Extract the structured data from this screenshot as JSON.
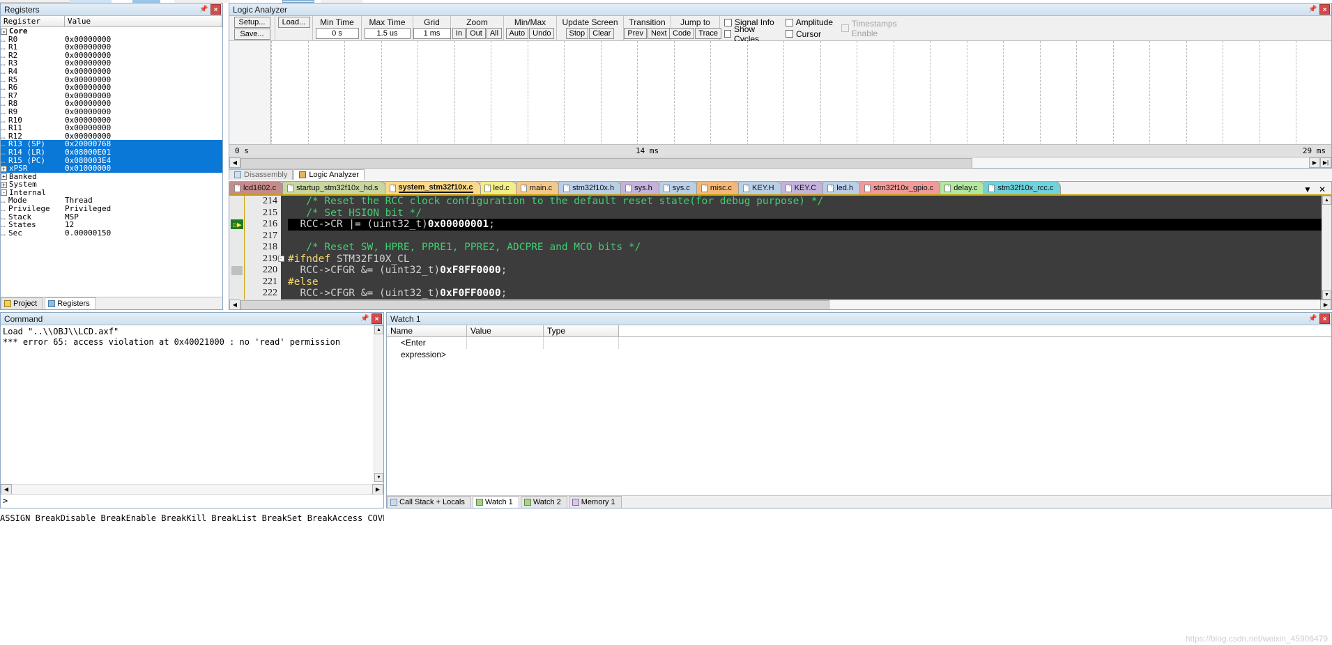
{
  "registers": {
    "title": "Registers",
    "columns": [
      "Register",
      "Value"
    ],
    "rows": [
      {
        "name": "Core",
        "value": "",
        "indent": 0,
        "expander": "-",
        "group": true,
        "selected": false
      },
      {
        "name": "R0",
        "value": "0x00000000",
        "indent": 2,
        "expander": "",
        "group": false,
        "selected": false
      },
      {
        "name": "R1",
        "value": "0x00000000",
        "indent": 2,
        "expander": "",
        "group": false,
        "selected": false
      },
      {
        "name": "R2",
        "value": "0x00000000",
        "indent": 2,
        "expander": "",
        "group": false,
        "selected": false
      },
      {
        "name": "R3",
        "value": "0x00000000",
        "indent": 2,
        "expander": "",
        "group": false,
        "selected": false
      },
      {
        "name": "R4",
        "value": "0x00000000",
        "indent": 2,
        "expander": "",
        "group": false,
        "selected": false
      },
      {
        "name": "R5",
        "value": "0x00000000",
        "indent": 2,
        "expander": "",
        "group": false,
        "selected": false
      },
      {
        "name": "R6",
        "value": "0x00000000",
        "indent": 2,
        "expander": "",
        "group": false,
        "selected": false
      },
      {
        "name": "R7",
        "value": "0x00000000",
        "indent": 2,
        "expander": "",
        "group": false,
        "selected": false
      },
      {
        "name": "R8",
        "value": "0x00000000",
        "indent": 2,
        "expander": "",
        "group": false,
        "selected": false
      },
      {
        "name": "R9",
        "value": "0x00000000",
        "indent": 2,
        "expander": "",
        "group": false,
        "selected": false
      },
      {
        "name": "R10",
        "value": "0x00000000",
        "indent": 2,
        "expander": "",
        "group": false,
        "selected": false
      },
      {
        "name": "R11",
        "value": "0x00000000",
        "indent": 2,
        "expander": "",
        "group": false,
        "selected": false
      },
      {
        "name": "R12",
        "value": "0x00000000",
        "indent": 2,
        "expander": "",
        "group": false,
        "selected": false
      },
      {
        "name": "R13 (SP)",
        "value": "0x20000768",
        "indent": 2,
        "expander": "",
        "group": false,
        "selected": true
      },
      {
        "name": "R14 (LR)",
        "value": "0x08000E01",
        "indent": 2,
        "expander": "",
        "group": false,
        "selected": true
      },
      {
        "name": "R15 (PC)",
        "value": "0x080003E4",
        "indent": 2,
        "expander": "",
        "group": false,
        "selected": true
      },
      {
        "name": "xPSR",
        "value": "0x01000000",
        "indent": 1,
        "expander": "+",
        "group": false,
        "selected": true
      },
      {
        "name": "Banked",
        "value": "",
        "indent": 0,
        "expander": "+",
        "group": false,
        "selected": false
      },
      {
        "name": "System",
        "value": "",
        "indent": 0,
        "expander": "+",
        "group": false,
        "selected": false
      },
      {
        "name": "Internal",
        "value": "",
        "indent": 0,
        "expander": "-",
        "group": false,
        "selected": false
      },
      {
        "name": "Mode",
        "value": "Thread",
        "indent": 2,
        "expander": "",
        "group": false,
        "selected": false
      },
      {
        "name": "Privilege",
        "value": "Privileged",
        "indent": 2,
        "expander": "",
        "group": false,
        "selected": false
      },
      {
        "name": "Stack",
        "value": "MSP",
        "indent": 2,
        "expander": "",
        "group": false,
        "selected": false
      },
      {
        "name": "States",
        "value": "12",
        "indent": 2,
        "expander": "",
        "group": false,
        "selected": false
      },
      {
        "name": "Sec",
        "value": "0.00000150",
        "indent": 2,
        "expander": "",
        "group": false,
        "selected": false
      }
    ],
    "bottom_tabs": [
      {
        "label": "Project",
        "active": false,
        "icon": "project-icon"
      },
      {
        "label": "Registers",
        "active": true,
        "icon": "registers-icon"
      }
    ]
  },
  "logic_analyzer": {
    "title": "Logic Analyzer",
    "buttons": {
      "setup": "Setup...",
      "load": "Load...",
      "save": "Save..."
    },
    "groups": [
      {
        "label": "Min Time",
        "value": "0 s"
      },
      {
        "label": "Max Time",
        "value": "1.5 us"
      },
      {
        "label": "Grid",
        "value": "1 ms"
      }
    ],
    "zoom": {
      "label": "Zoom",
      "buttons": [
        "In",
        "Out",
        "All"
      ]
    },
    "minmax": {
      "label": "Min/Max",
      "buttons": [
        "Auto",
        "Undo"
      ]
    },
    "update_screen": {
      "label": "Update Screen",
      "buttons": [
        "Stop",
        "Clear"
      ]
    },
    "transition": {
      "label": "Transition",
      "buttons": [
        "Prev",
        "Next"
      ]
    },
    "jump_to": {
      "label": "Jump to",
      "buttons": [
        "Code",
        "Trace"
      ]
    },
    "checkboxes": [
      {
        "label": "Signal Info",
        "checked": false,
        "disabled": false
      },
      {
        "label": "Show Cycles",
        "checked": false,
        "disabled": false
      },
      {
        "label": "Amplitude",
        "checked": false,
        "disabled": false
      },
      {
        "label": "Cursor",
        "checked": false,
        "disabled": false
      },
      {
        "label": "Timestamps Enable",
        "checked": false,
        "disabled": true
      }
    ],
    "axis": {
      "left": "0 s",
      "center": "14 ms",
      "right": "29 ms"
    }
  },
  "view_tabs": [
    {
      "label": "Disassembly",
      "active": false,
      "icon": "disassembly-icon"
    },
    {
      "label": "Logic Analyzer",
      "active": true,
      "icon": "logic-analyzer-icon"
    }
  ],
  "editor": {
    "file_tabs": [
      {
        "label": "lcd1602.c",
        "color": "#c58b8b",
        "active": false
      },
      {
        "label": "startup_stm32f10x_hd.s",
        "color": "#c8d6a0",
        "active": false
      },
      {
        "label": "system_stm32f10x.c",
        "color": "#fcd98a",
        "active": true
      },
      {
        "label": "led.c",
        "color": "#f2ef88",
        "active": false
      },
      {
        "label": "main.c",
        "color": "#f3c98b",
        "active": false
      },
      {
        "label": "stm32f10x.h",
        "color": "#b9cfe8",
        "active": false
      },
      {
        "label": "sys.h",
        "color": "#c4b2dd",
        "active": false
      },
      {
        "label": "sys.c",
        "color": "#b9cfe8",
        "active": false
      },
      {
        "label": "misc.c",
        "color": "#f3b878",
        "active": false
      },
      {
        "label": "KEY.H",
        "color": "#b9cfe8",
        "active": false
      },
      {
        "label": "KEY.C",
        "color": "#c4b2dd",
        "active": false
      },
      {
        "label": "led.h",
        "color": "#b9cfe8",
        "active": false
      },
      {
        "label": "stm32f10x_gpio.c",
        "color": "#f19a9a",
        "active": false
      },
      {
        "label": "delay.c",
        "color": "#b2e8a0",
        "active": false
      },
      {
        "label": "stm32f10x_rcc.c",
        "color": "#6fd3dd",
        "active": false
      }
    ],
    "tab_controls": {
      "dropdown": "▼",
      "close": "✕"
    },
    "lines": [
      {
        "no": "214",
        "text": "   /* Reset the RCC clock configuration to the default reset state(for debug purpose) */",
        "kind": "comment",
        "fold": "",
        "marker": "",
        "current": false
      },
      {
        "no": "215",
        "text": "   /* Set HSION bit */",
        "kind": "comment",
        "fold": "",
        "marker": "",
        "current": false
      },
      {
        "no": "216",
        "text": "  RCC->CR |= (uint32_t)0x00000001;",
        "kind": "code",
        "fold": "",
        "marker": "pc-arrow",
        "current": true
      },
      {
        "no": "217",
        "text": "",
        "kind": "code",
        "fold": "",
        "marker": "",
        "current": false
      },
      {
        "no": "218",
        "text": "   /* Reset SW, HPRE, PPRE1, PPRE2, ADCPRE and MCO bits */",
        "kind": "comment",
        "fold": "",
        "marker": "",
        "current": false
      },
      {
        "no": "219",
        "text": "#ifndef STM32F10X_CL",
        "kind": "pp",
        "fold": "-",
        "marker": "",
        "current": false
      },
      {
        "no": "220",
        "text": "  RCC->CFGR &= (uint32_t)0xF8FF0000;",
        "kind": "code",
        "fold": "",
        "marker": "gray",
        "current": false
      },
      {
        "no": "221",
        "text": "#else",
        "kind": "pp",
        "fold": "",
        "marker": "",
        "current": false
      },
      {
        "no": "222",
        "text": "  RCC->CFGR &= (uint32_t)0xF0FF0000;",
        "kind": "code",
        "fold": "",
        "marker": "",
        "current": false
      }
    ]
  },
  "command": {
    "title": "Command",
    "lines": [
      "Load \"..\\\\OBJ\\\\LCD.axf\"",
      "*** error 65: access violation at 0x40021000 : no 'read' permission"
    ],
    "prompt": ">"
  },
  "watch": {
    "title": "Watch 1",
    "columns": [
      "Name",
      "Value",
      "Type"
    ],
    "rows": [
      {
        "name": "<Enter expression>",
        "value": "",
        "type": ""
      }
    ],
    "bottom_tabs": [
      {
        "label": "Call Stack + Locals",
        "active": false,
        "icon": "call-stack-icon"
      },
      {
        "label": "Watch 1",
        "active": true,
        "icon": "watch-icon"
      },
      {
        "label": "Watch 2",
        "active": false,
        "icon": "watch-icon"
      },
      {
        "label": "Memory 1",
        "active": false,
        "icon": "memory-icon"
      }
    ]
  },
  "statusbar": {
    "text": "ASSIGN BreakDisable BreakEnable BreakKill BreakList BreakSet BreakAccess COVERAGE"
  },
  "watermark": "https://blog.csdn.net/weixin_45906479",
  "colors": {
    "selection": "#0a78d7",
    "comment_green": "#3fd070",
    "preproc_yellow": "#f5d76e",
    "current_line_bg": "#000000",
    "editor_bg": "#3c3c3c",
    "tab_underline": "#c8a100"
  }
}
